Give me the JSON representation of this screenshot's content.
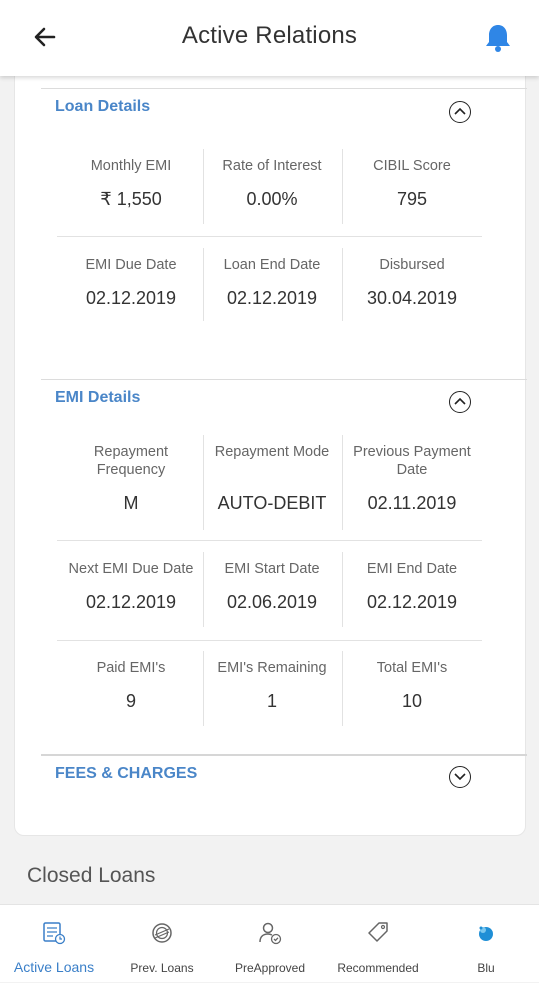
{
  "header": {
    "title": "Active Relations"
  },
  "loan_details": {
    "title": "Loan Details",
    "rows": [
      [
        {
          "label": "Monthly EMI",
          "value": "₹ 1,550"
        },
        {
          "label": "Rate of Interest",
          "value": "0.00%"
        },
        {
          "label": "CIBIL Score",
          "value": "795"
        }
      ],
      [
        {
          "label": "EMI Due Date",
          "value": "02.12.2019"
        },
        {
          "label": "Loan End Date",
          "value": "02.12.2019"
        },
        {
          "label": "Disbursed",
          "value": "30.04.2019"
        }
      ]
    ]
  },
  "emi_details": {
    "title": "EMI Details",
    "rows": [
      [
        {
          "label": "Repayment Frequency",
          "value": "M"
        },
        {
          "label": "Repayment Mode",
          "value": "AUTO-DEBIT"
        },
        {
          "label": "Previous Payment Date",
          "value": "02.11.2019"
        }
      ],
      [
        {
          "label": "Next EMI Due Date",
          "value": "02.12.2019"
        },
        {
          "label": "EMI Start Date",
          "value": "02.06.2019"
        },
        {
          "label": "EMI End Date",
          "value": "02.12.2019"
        }
      ],
      [
        {
          "label": "Paid EMI's",
          "value": "9"
        },
        {
          "label": "EMI's Remaining",
          "value": "1"
        },
        {
          "label": "Total EMI's",
          "value": "10"
        }
      ]
    ]
  },
  "fees": {
    "title": "FEES & CHARGES"
  },
  "closed_loans": {
    "title": "Closed Loans"
  },
  "bottom_nav": [
    {
      "label": "Active Loans",
      "icon": "active-loans-icon",
      "active": true
    },
    {
      "label": "Prev. Loans",
      "icon": "prev-loans-icon",
      "active": false
    },
    {
      "label": "PreApproved",
      "icon": "preapproved-icon",
      "active": false
    },
    {
      "label": "Recommended",
      "icon": "recommended-tag-icon",
      "active": false
    },
    {
      "label": "Blu",
      "icon": "blu-icon",
      "active": false
    }
  ],
  "colors": {
    "accent": "#4a86c8",
    "bell": "#2f86e6"
  }
}
